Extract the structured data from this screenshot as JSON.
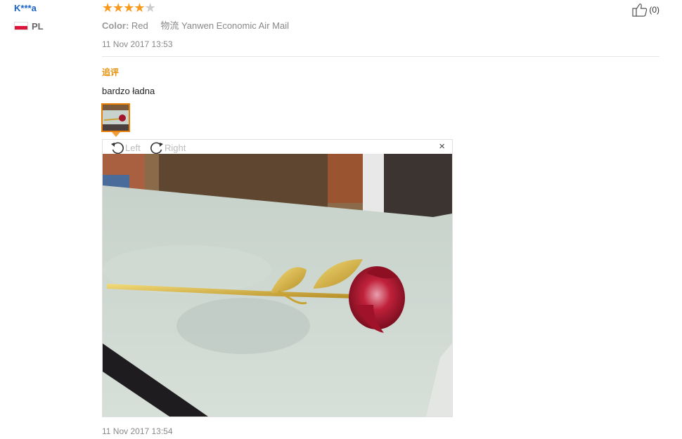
{
  "review": {
    "user_name": "K***a",
    "country": "PL",
    "rating": 4,
    "rating_max": 5,
    "color_label": "Color:",
    "color_value": "Red",
    "shipping_label": "物流",
    "shipping_value": "Yanwen Economic Air Mail",
    "helpful_count": "(0)",
    "date": "11 Nov 2017 13:53",
    "additional_label": "追评",
    "additional_text": "bardzo ładna",
    "additional_date": "11 Nov 2017 13:54"
  },
  "viewer": {
    "rotate_left_label": "Left",
    "rotate_right_label": "Right",
    "close_label": "×"
  },
  "icons": {
    "thumbs_up": "thumbs-up-icon",
    "rotate_left": "rotate-left-icon",
    "rotate_right": "rotate-right-icon",
    "close": "close-icon",
    "flag": "poland-flag-icon"
  },
  "colors": {
    "star": "#f89a1c",
    "user_link": "#1a64c8",
    "accent": "#e8920a"
  }
}
